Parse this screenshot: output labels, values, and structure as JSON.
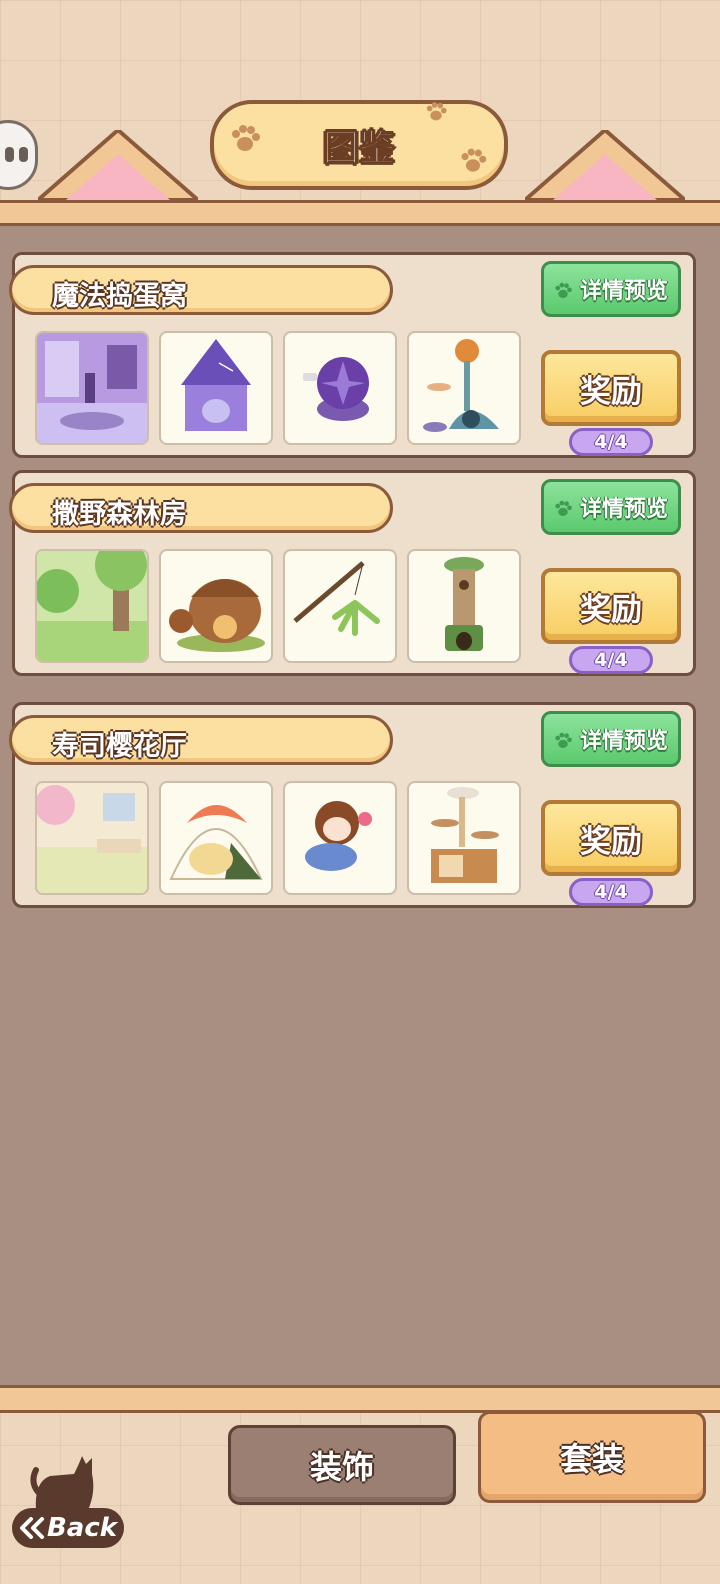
{
  "header": {
    "title": "图鉴"
  },
  "sets": [
    {
      "name": "魔法捣蛋窝",
      "detail_label": "详情预览",
      "reward_label": "奖励",
      "progress": "4/4",
      "items": [
        "room-purple-icon",
        "witch-house-icon",
        "magic-ball-icon",
        "pumpkin-cat-tree-icon"
      ]
    },
    {
      "name": "撒野森林房",
      "detail_label": "详情预览",
      "reward_label": "奖励",
      "progress": "4/4",
      "items": [
        "forest-room-icon",
        "acorn-house-icon",
        "teaser-wand-icon",
        "tree-cat-tower-icon"
      ]
    },
    {
      "name": "寿司樱花厅",
      "detail_label": "详情预览",
      "reward_label": "奖励",
      "progress": "4/4",
      "items": [
        "sakura-room-icon",
        "sushi-bed-icon",
        "kokeshi-toy-icon",
        "wood-cat-tree-icon"
      ]
    }
  ],
  "tabs": {
    "decor": "装饰",
    "suit": "套装",
    "active": "suit"
  },
  "back": {
    "label": "Back"
  },
  "colors": {
    "accent_green": "#5bc96e",
    "accent_gold": "#f8cd62",
    "progress_purple": "#c9a7f0",
    "background": "#a98e82"
  }
}
